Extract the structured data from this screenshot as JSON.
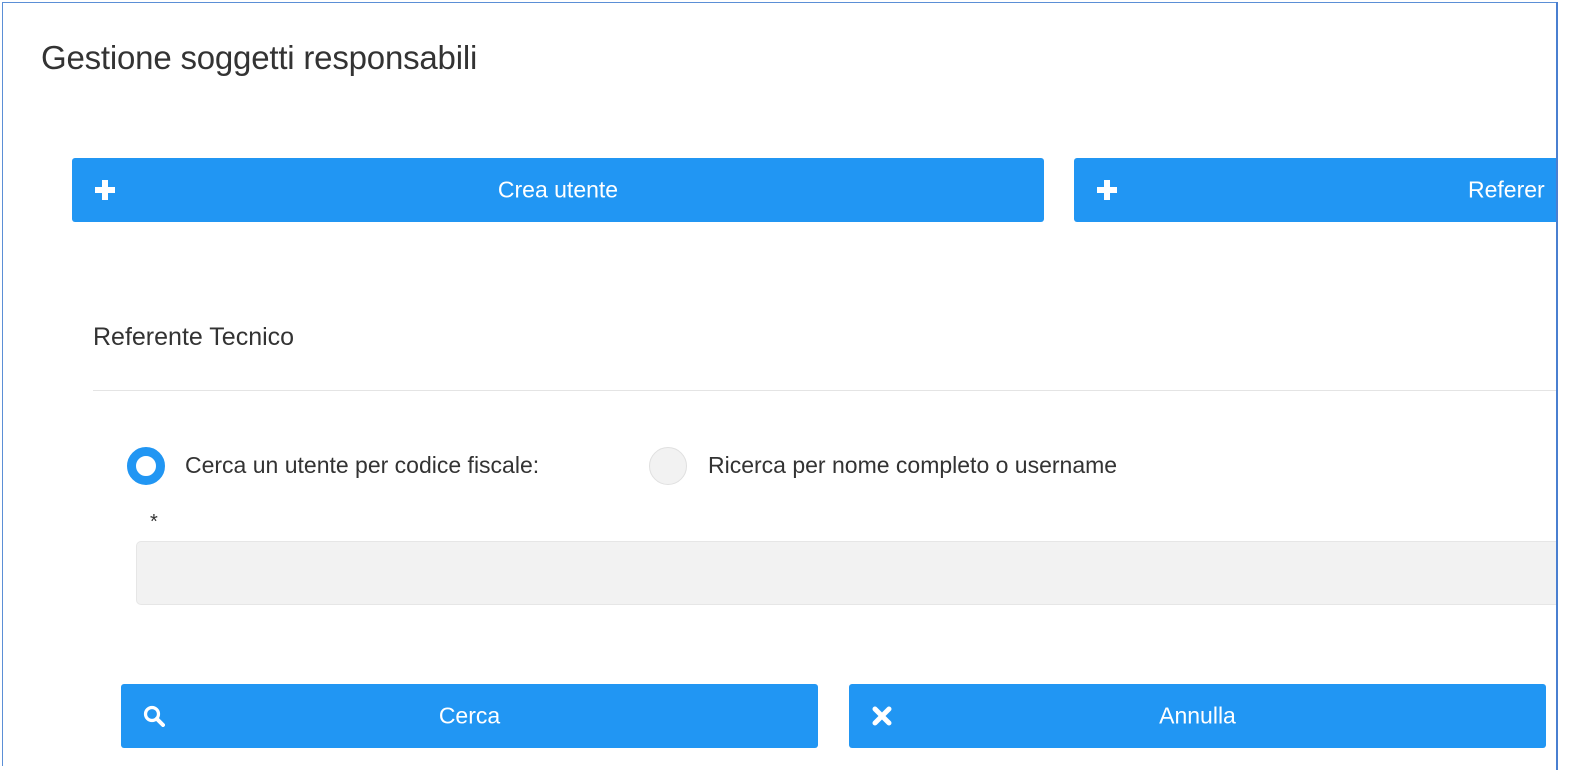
{
  "page": {
    "title": "Gestione soggetti responsabili"
  },
  "actions": {
    "crea_utente": {
      "label": "Crea utente",
      "icon": "plus-icon"
    },
    "referente": {
      "label": "Referer",
      "icon": "plus-icon"
    }
  },
  "section": {
    "title": "Referente Tecnico"
  },
  "search_mode": {
    "options": [
      {
        "label": "Cerca un utente per codice fiscale:",
        "selected": true
      },
      {
        "label": "Ricerca per nome completo o username",
        "selected": false
      }
    ]
  },
  "search_field": {
    "required_marker": "*",
    "value": "",
    "placeholder": ""
  },
  "footer": {
    "cerca": {
      "label": "Cerca",
      "icon": "search-icon"
    },
    "annulla": {
      "label": "Annulla",
      "icon": "close-icon"
    }
  },
  "colors": {
    "accent": "#2196f3",
    "frame_border": "#5b8fd6",
    "input_bg": "#f2f2f2",
    "text": "#333333"
  }
}
